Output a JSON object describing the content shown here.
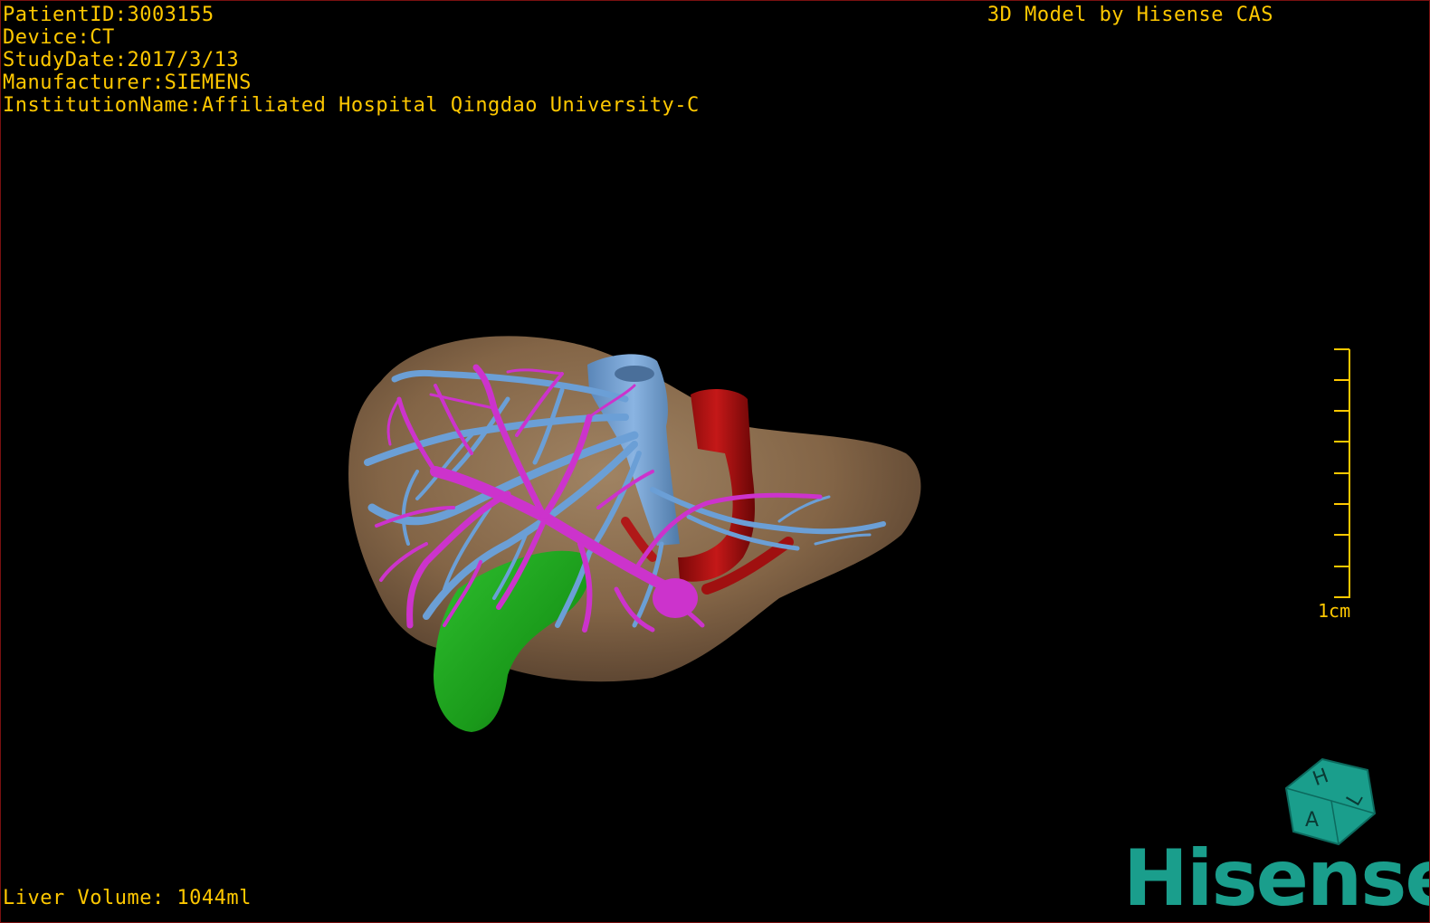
{
  "patient_info": {
    "patient_id": "PatientID:3003155",
    "device": "Device:CT",
    "study_date": "StudyDate:2017/3/13",
    "manufacturer": "Manufacturer:SIEMENS",
    "institution": "InstitutionName:Affiliated Hospital Qingdao University-C"
  },
  "credit": "3D Model by Hisense CAS",
  "liver_volume": "Liver Volume: 1044ml",
  "scale_bar": {
    "label": "1cm",
    "color": "#ffc800"
  },
  "orientation_cube": {
    "labels": [
      "H",
      "A",
      "L"
    ],
    "color": "#1a9e8c"
  },
  "brand": {
    "name": "Hisense",
    "color": "#1a9e8c"
  },
  "model_colors": {
    "liver": "#8a6a4a",
    "portal_vein": "#cc33cc",
    "hepatic_vein": "#6b9fd6",
    "artery": "#b01010",
    "gallbladder": "#1fa51f"
  }
}
